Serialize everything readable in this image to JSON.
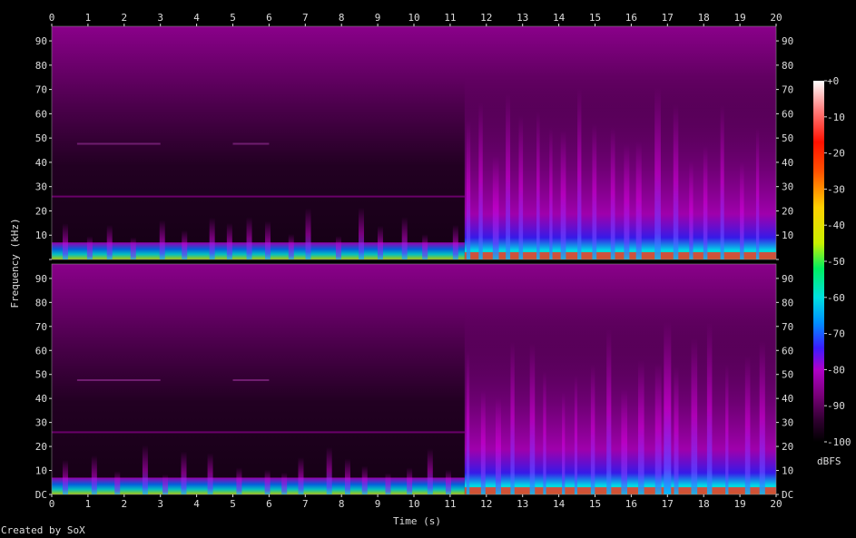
{
  "chart_data": {
    "type": "heatmap",
    "subtype": "spectrogram",
    "channels": 2,
    "xlabel": "Time (s)",
    "ylabel": "Frequency (kHz)",
    "x_ticks": [
      "0",
      "1",
      "2",
      "3",
      "4",
      "5",
      "6",
      "7",
      "8",
      "9",
      "10",
      "11",
      "12",
      "13",
      "14",
      "15",
      "16",
      "17",
      "18",
      "19",
      "20"
    ],
    "xlim": [
      0,
      20
    ],
    "y_ticks": [
      "DC",
      "10",
      "20",
      "30",
      "40",
      "50",
      "60",
      "70",
      "80",
      "90"
    ],
    "ylim_khz": [
      0,
      96
    ],
    "colorbar": {
      "label": "dBFS",
      "ticks": [
        "+0",
        "-10",
        "-20",
        "-30",
        "-40",
        "-50",
        "-60",
        "-70",
        "-80",
        "-90",
        "-100"
      ],
      "range": [
        -100,
        0
      ],
      "colors": [
        "#000000",
        "#300030",
        "#7a007a",
        "#b000c8",
        "#3a1cff",
        "#0090ff",
        "#00e0e0",
        "#00f060",
        "#c8f000",
        "#ffd000",
        "#ff5000",
        "#ff1000",
        "#ff8080",
        "#ffffff"
      ]
    },
    "notes": "Quiet first ~11.4 s (energy concentrated below ~8 kHz, faint bands near 26 kHz and 48 kHz); louder, broadband transients every ~0.4 s from ~11.4 s to 20 s reaching ~70 kHz; peak event near 16.9 s in channel 2."
  },
  "footer": {
    "credit": "Created by SoX"
  },
  "colors": {
    "background": "#000000",
    "text": "#dddddd"
  }
}
